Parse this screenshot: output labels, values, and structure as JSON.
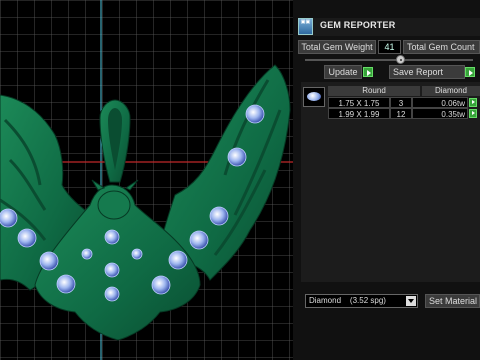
{
  "panel": {
    "title": "GEM REPORTER",
    "icon": "gem-reporter-icon",
    "total_gem_weight_label": "Total Gem Weight",
    "total_gem_weight_value": "41",
    "total_gem_count_label": "Total Gem Count",
    "update_label": "Update",
    "save_report_label": "Save Report",
    "table": {
      "headers": [
        "Round",
        "Diamond"
      ],
      "rows": [
        {
          "size": "1.75 X 1.75",
          "count": "3",
          "weight": "0.06tw"
        },
        {
          "size": "1.99 X 1.99",
          "count": "12",
          "weight": "0.35tw"
        }
      ]
    },
    "material_select": "Diamond    (3.52 spg)",
    "set_material_label": "Set Material"
  },
  "colors": {
    "model_green": "#0f6a44",
    "grid_line": "#6a6a6a",
    "axis_red": "#c0282a",
    "axis_cyan": "#4fc7e0",
    "panel_bg": "#111111",
    "play_green": "#37a33a"
  }
}
